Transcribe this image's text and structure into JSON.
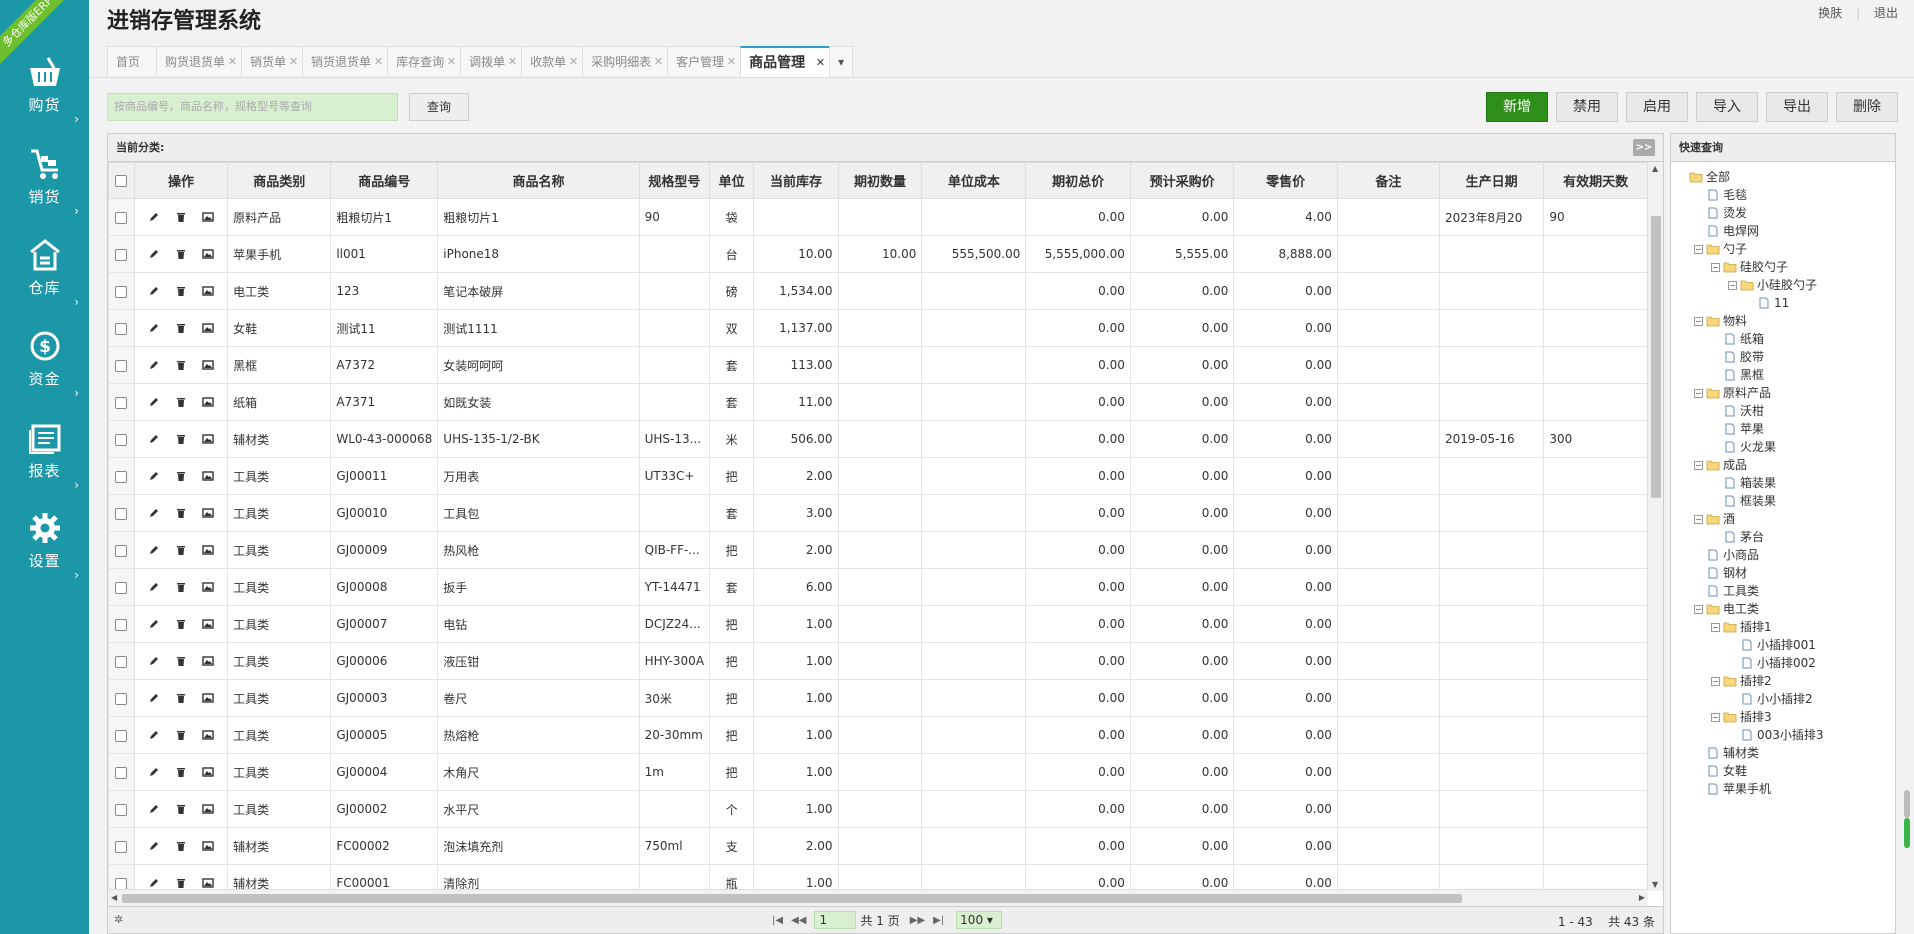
{
  "app": {
    "title": "进销存管理系统",
    "badge": "多仓库版ERP"
  },
  "toplinks": {
    "skin": "换肤",
    "logout": "退出"
  },
  "sidebar": [
    {
      "label": "购货",
      "icon": "basket-icon"
    },
    {
      "label": "销货",
      "icon": "cart-icon"
    },
    {
      "label": "仓库",
      "icon": "warehouse-icon"
    },
    {
      "label": "资金",
      "icon": "dollar-icon"
    },
    {
      "label": "报表",
      "icon": "report-icon"
    },
    {
      "label": "设置",
      "icon": "gear-icon"
    }
  ],
  "tabs": [
    "首页",
    "购货退货单",
    "销货单",
    "销货退货单",
    "库存查询",
    "调拨单",
    "收款单",
    "采购明细表",
    "客户管理",
    "商品管理"
  ],
  "search": {
    "placeholder": "按商品编号，商品名称，规格型号等查询",
    "button": "查询"
  },
  "toolbar": {
    "add": "新增",
    "disable": "禁用",
    "enable": "启用",
    "import": "导入",
    "export": "导出",
    "delete": "删除"
  },
  "grid": {
    "category_label": "当前分类:",
    "expand_label": ">>",
    "columns": [
      "操作",
      "商品类别",
      "商品编号",
      "商品名称",
      "规格型号",
      "单位",
      "当前库存",
      "期初数量",
      "单位成本",
      "期初总价",
      "预计采购价",
      "零售价",
      "备注",
      "生产日期",
      "有效期天数"
    ],
    "rows": [
      [
        "原料产品",
        "粗粮切片1",
        "粗粮切片1",
        "90",
        "袋",
        "",
        "",
        "",
        "0.00",
        "0.00",
        "4.00",
        "",
        "2023年8月20",
        "90"
      ],
      [
        "苹果手机",
        "ll001",
        "iPhone18",
        "",
        "台",
        "10.00",
        "10.00",
        "555,500.00",
        "5,555,000.00",
        "5,555.00",
        "8,888.00",
        "",
        "",
        ""
      ],
      [
        "电工类",
        "123",
        "笔记本破屏",
        "",
        "磅",
        "1,534.00",
        "",
        "",
        "0.00",
        "0.00",
        "0.00",
        "",
        "",
        ""
      ],
      [
        "女鞋",
        "测试11",
        "测试1111",
        "",
        "双",
        "1,137.00",
        "",
        "",
        "0.00",
        "0.00",
        "0.00",
        "",
        "",
        ""
      ],
      [
        "黑框",
        "A7372",
        "女装呵呵呵",
        "",
        "套",
        "113.00",
        "",
        "",
        "0.00",
        "0.00",
        "0.00",
        "",
        "",
        ""
      ],
      [
        "纸箱",
        "A7371",
        "如既女装",
        "",
        "套",
        "11.00",
        "",
        "",
        "0.00",
        "0.00",
        "0.00",
        "",
        "",
        ""
      ],
      [
        "辅材类",
        "WL0-43-000068",
        "UHS-135-1/2-BK",
        "UHS-13...",
        "米",
        "506.00",
        "",
        "",
        "0.00",
        "0.00",
        "0.00",
        "",
        "2019-05-16",
        "300"
      ],
      [
        "工具类",
        "GJ00011",
        "万用表",
        "UT33C+",
        "把",
        "2.00",
        "",
        "",
        "0.00",
        "0.00",
        "0.00",
        "",
        "",
        ""
      ],
      [
        "工具类",
        "GJ00010",
        "工具包",
        "",
        "套",
        "3.00",
        "",
        "",
        "0.00",
        "0.00",
        "0.00",
        "",
        "",
        ""
      ],
      [
        "工具类",
        "GJ00009",
        "热风枪",
        "QIB-FF-...",
        "把",
        "2.00",
        "",
        "",
        "0.00",
        "0.00",
        "0.00",
        "",
        "",
        ""
      ],
      [
        "工具类",
        "GJ00008",
        "扳手",
        "YT-14471",
        "套",
        "6.00",
        "",
        "",
        "0.00",
        "0.00",
        "0.00",
        "",
        "",
        ""
      ],
      [
        "工具类",
        "GJ00007",
        "电钻",
        "DCJZ24...",
        "把",
        "1.00",
        "",
        "",
        "0.00",
        "0.00",
        "0.00",
        "",
        "",
        ""
      ],
      [
        "工具类",
        "GJ00006",
        "液压钳",
        "HHY-300A",
        "把",
        "1.00",
        "",
        "",
        "0.00",
        "0.00",
        "0.00",
        "",
        "",
        ""
      ],
      [
        "工具类",
        "GJ00003",
        "卷尺",
        "30米",
        "把",
        "1.00",
        "",
        "",
        "0.00",
        "0.00",
        "0.00",
        "",
        "",
        ""
      ],
      [
        "工具类",
        "GJ00005",
        "热熔枪",
        "20-30mm",
        "把",
        "1.00",
        "",
        "",
        "0.00",
        "0.00",
        "0.00",
        "",
        "",
        ""
      ],
      [
        "工具类",
        "GJ00004",
        "木角尺",
        "1m",
        "把",
        "1.00",
        "",
        "",
        "0.00",
        "0.00",
        "0.00",
        "",
        "",
        ""
      ],
      [
        "工具类",
        "GJ00002",
        "水平尺",
        "",
        "个",
        "1.00",
        "",
        "",
        "0.00",
        "0.00",
        "0.00",
        "",
        "",
        ""
      ],
      [
        "辅材类",
        "FC00002",
        "泡沫填充剂",
        "750ml",
        "支",
        "2.00",
        "",
        "",
        "0.00",
        "0.00",
        "0.00",
        "",
        "",
        ""
      ],
      [
        "辅材类",
        "FC00001",
        "清除剂",
        "",
        "瓶",
        "1.00",
        "",
        "",
        "0.00",
        "0.00",
        "0.00",
        "",
        "",
        ""
      ]
    ]
  },
  "pager": {
    "page": "1",
    "total_pages": "共 1 页",
    "page_size": "100",
    "range": "1 - 43",
    "total": "共 43 条"
  },
  "quick": {
    "title": "快速查询",
    "tree": [
      {
        "label": "全部",
        "level": 0,
        "type": "folder",
        "toggle": ""
      },
      {
        "label": "毛毯",
        "level": 1,
        "type": "file",
        "toggle": ""
      },
      {
        "label": "烫发",
        "level": 1,
        "type": "file",
        "toggle": ""
      },
      {
        "label": "电焊网",
        "level": 1,
        "type": "file",
        "toggle": ""
      },
      {
        "label": "勺子",
        "level": 1,
        "type": "folder",
        "toggle": "−"
      },
      {
        "label": "硅胶勺子",
        "level": 2,
        "type": "folder",
        "toggle": "−"
      },
      {
        "label": "小硅胶勺子",
        "level": 3,
        "type": "folder",
        "toggle": "−"
      },
      {
        "label": "11",
        "level": 4,
        "type": "file",
        "toggle": ""
      },
      {
        "label": "物料",
        "level": 1,
        "type": "folder",
        "toggle": "−"
      },
      {
        "label": "纸箱",
        "level": 2,
        "type": "file",
        "toggle": ""
      },
      {
        "label": "胶带",
        "level": 2,
        "type": "file",
        "toggle": ""
      },
      {
        "label": "黑框",
        "level": 2,
        "type": "file",
        "toggle": ""
      },
      {
        "label": "原料产品",
        "level": 1,
        "type": "folder",
        "toggle": "−"
      },
      {
        "label": "沃柑",
        "level": 2,
        "type": "file",
        "toggle": ""
      },
      {
        "label": "苹果",
        "level": 2,
        "type": "file",
        "toggle": ""
      },
      {
        "label": "火龙果",
        "level": 2,
        "type": "file",
        "toggle": ""
      },
      {
        "label": "成品",
        "level": 1,
        "type": "folder",
        "toggle": "−"
      },
      {
        "label": "箱装果",
        "level": 2,
        "type": "file",
        "toggle": ""
      },
      {
        "label": "框装果",
        "level": 2,
        "type": "file",
        "toggle": ""
      },
      {
        "label": "酒",
        "level": 1,
        "type": "folder",
        "toggle": "−"
      },
      {
        "label": "茅台",
        "level": 2,
        "type": "file",
        "toggle": ""
      },
      {
        "label": "小商品",
        "level": 1,
        "type": "file",
        "toggle": ""
      },
      {
        "label": "钢材",
        "level": 1,
        "type": "file",
        "toggle": ""
      },
      {
        "label": "工具类",
        "level": 1,
        "type": "file",
        "toggle": ""
      },
      {
        "label": "电工类",
        "level": 1,
        "type": "folder",
        "toggle": "−"
      },
      {
        "label": "插排1",
        "level": 2,
        "type": "folder",
        "toggle": "−"
      },
      {
        "label": "小插排001",
        "level": 3,
        "type": "file",
        "toggle": ""
      },
      {
        "label": "小插排002",
        "level": 3,
        "type": "file",
        "toggle": ""
      },
      {
        "label": "插排2",
        "level": 2,
        "type": "folder",
        "toggle": "−"
      },
      {
        "label": "小小插排2",
        "level": 3,
        "type": "file",
        "toggle": ""
      },
      {
        "label": "插排3",
        "level": 2,
        "type": "folder",
        "toggle": "−"
      },
      {
        "label": "003小插排3",
        "level": 3,
        "type": "file",
        "toggle": ""
      },
      {
        "label": "辅材类",
        "level": 1,
        "type": "file",
        "toggle": ""
      },
      {
        "label": "女鞋",
        "level": 1,
        "type": "file",
        "toggle": ""
      },
      {
        "label": "苹果手机",
        "level": 1,
        "type": "file",
        "toggle": ""
      }
    ]
  }
}
